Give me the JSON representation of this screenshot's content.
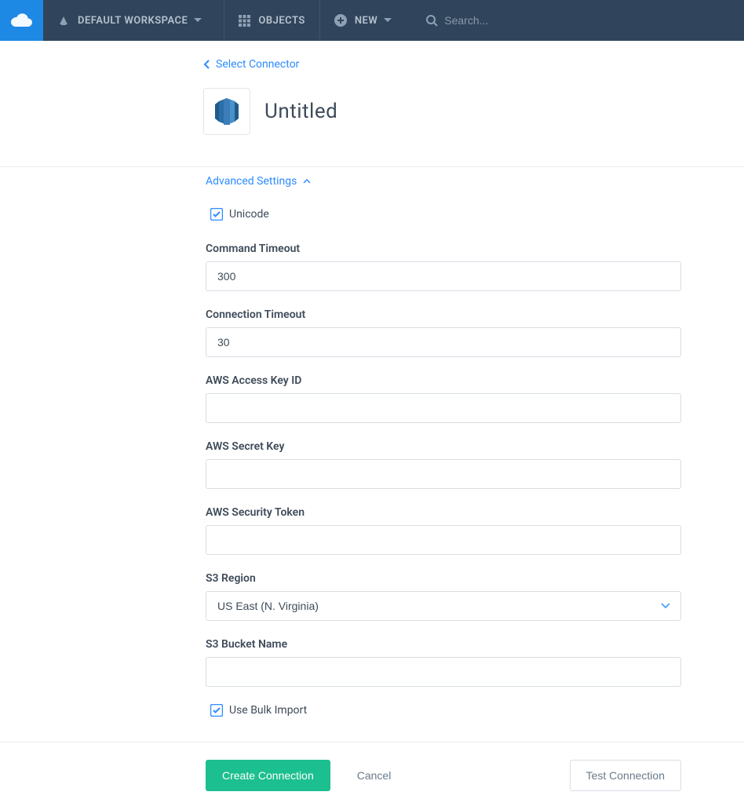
{
  "nav": {
    "workspace_label": "DEFAULT WORKSPACE",
    "objects_label": "OBJECTS",
    "new_label": "NEW",
    "search_placeholder": "Search..."
  },
  "back_link": "Select Connector",
  "page_title": "Untitled",
  "advanced_label": "Advanced Settings",
  "fields": {
    "unicode_label": "Unicode",
    "unicode_checked": true,
    "command_timeout_label": "Command Timeout",
    "command_timeout_value": "300",
    "connection_timeout_label": "Connection Timeout",
    "connection_timeout_value": "30",
    "aws_access_key_label": "AWS Access Key ID",
    "aws_access_key_value": "",
    "aws_secret_key_label": "AWS Secret Key",
    "aws_secret_key_value": "",
    "aws_security_token_label": "AWS Security Token",
    "aws_security_token_value": "",
    "s3_region_label": "S3 Region",
    "s3_region_value": "US East (N. Virginia)",
    "s3_bucket_label": "S3 Bucket Name",
    "s3_bucket_value": "",
    "bulk_import_label": "Use Bulk Import",
    "bulk_import_checked": true
  },
  "actions": {
    "create_label": "Create Connection",
    "cancel_label": "Cancel",
    "test_label": "Test Connection"
  },
  "colors": {
    "primary_blue": "#2d8cff",
    "action_green": "#1cbf8f",
    "nav_bg": "#30455c"
  }
}
